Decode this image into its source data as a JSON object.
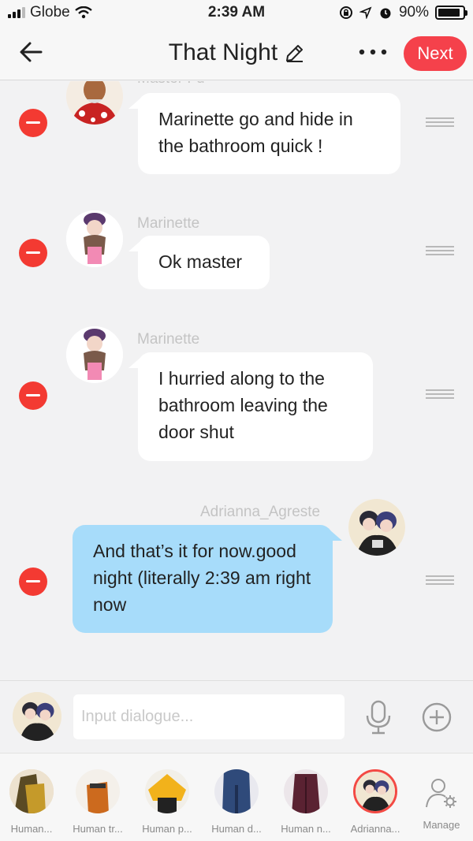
{
  "status_bar": {
    "carrier": "Globe",
    "time": "2:39 AM",
    "battery": "90%",
    "battery_level": 0.9
  },
  "header": {
    "back_icon": "arrow-left-icon",
    "title": "That Night",
    "edit_icon": "pencil-icon",
    "more_icon": "more-dots-icon",
    "next_label": "Next",
    "accent": "#f5414b"
  },
  "messages": [
    {
      "speaker": "Master Fu",
      "side": "left",
      "text": "Marinette go and hide in the bathroom quick !"
    },
    {
      "speaker": "Marinette",
      "side": "left",
      "text": "Ok master"
    },
    {
      "speaker": "Marinette",
      "side": "left",
      "text": "I hurried along to the bathroom leaving the door shut"
    },
    {
      "speaker": "Adrianna_Agreste",
      "side": "right",
      "text": "And that’s it for now.good night (literally 2:39 am right now"
    }
  ],
  "input": {
    "placeholder": "Input dialogue...",
    "mic_icon": "microphone-icon",
    "add_icon": "plus-circle-icon"
  },
  "characters": [
    {
      "label": "Human...",
      "selected": false
    },
    {
      "label": "Human tr...",
      "selected": false
    },
    {
      "label": "Human p...",
      "selected": false
    },
    {
      "label": "Human d...",
      "selected": false
    },
    {
      "label": "Human n...",
      "selected": false
    },
    {
      "label": "Adrianna...",
      "selected": true
    }
  ],
  "manage": {
    "label": "Manage",
    "icon": "manage-user-gear-icon"
  },
  "colors": {
    "bubble_right": "#a7dcfa",
    "bubble_left": "#ffffff",
    "remove": "#f33a32"
  }
}
